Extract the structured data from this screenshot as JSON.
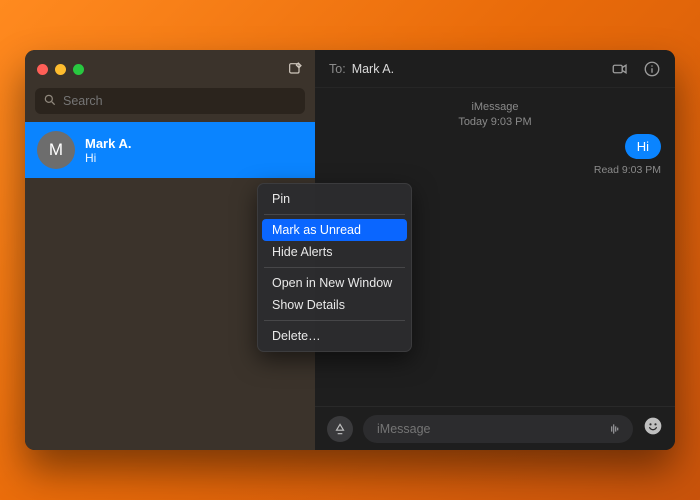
{
  "window": {
    "app": "Messages"
  },
  "sidebar": {
    "search_placeholder": "Search",
    "compose_icon": "compose-icon"
  },
  "conversations": [
    {
      "name": "Mark A.",
      "preview": "Hi",
      "avatar_initial": "M",
      "time": ""
    }
  ],
  "context_menu": {
    "items": [
      {
        "label": "Pin",
        "highlighted": false
      },
      {
        "sep": true
      },
      {
        "label": "Mark as Unread",
        "highlighted": true
      },
      {
        "label": "Hide Alerts",
        "highlighted": false
      },
      {
        "sep": true
      },
      {
        "label": "Open in New Window",
        "highlighted": false
      },
      {
        "label": "Show Details",
        "highlighted": false
      },
      {
        "sep": true
      },
      {
        "label": "Delete…",
        "highlighted": false
      }
    ]
  },
  "chat": {
    "to_label": "To:",
    "to_name": "Mark A.",
    "service": "iMessage",
    "timestamp": "Today 9:03 PM",
    "messages": [
      {
        "text": "Hi",
        "outgoing": true
      }
    ],
    "read_receipt": "Read 9:03 PM",
    "input_placeholder": "iMessage"
  },
  "icons": {
    "facetime": "facetime-icon",
    "info": "info-icon",
    "apps": "appstore-icon",
    "waveform": "waveform-icon",
    "emoji": "emoji-icon"
  }
}
